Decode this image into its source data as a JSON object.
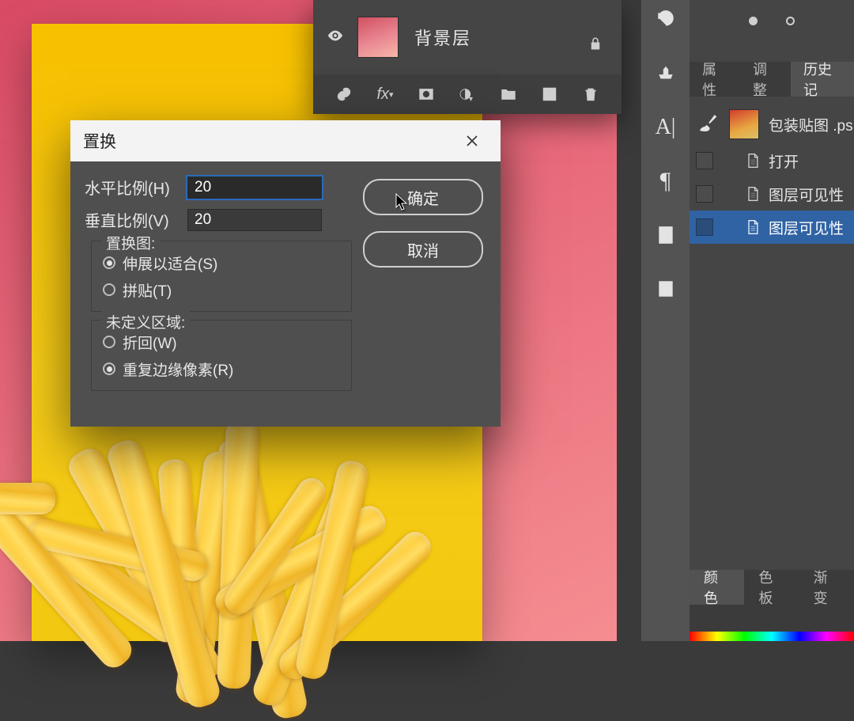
{
  "layers": {
    "row": {
      "name": "背景层"
    }
  },
  "rightpanel": {
    "tabs": {
      "a": "属性",
      "b": "调整",
      "c": "历史记"
    },
    "histdoc": "包装贴图 .ps",
    "items": [
      "打开",
      "图层可见性",
      "图层可见性"
    ],
    "colors": {
      "a": "颜色",
      "b": "色板",
      "c": "渐变"
    }
  },
  "dialog": {
    "title": "置换",
    "h_label": "水平比例(H)",
    "h_val": "20",
    "v_label": "垂直比例(V)",
    "v_val": "20",
    "grp1": "置换图:",
    "g1_a": "伸展以适合(S)",
    "g1_b": "拼贴(T)",
    "grp2": "未定义区域:",
    "g2_a": "折回(W)",
    "g2_b": "重复边缘像素(R)",
    "ok": "确定",
    "cancel": "取消"
  }
}
